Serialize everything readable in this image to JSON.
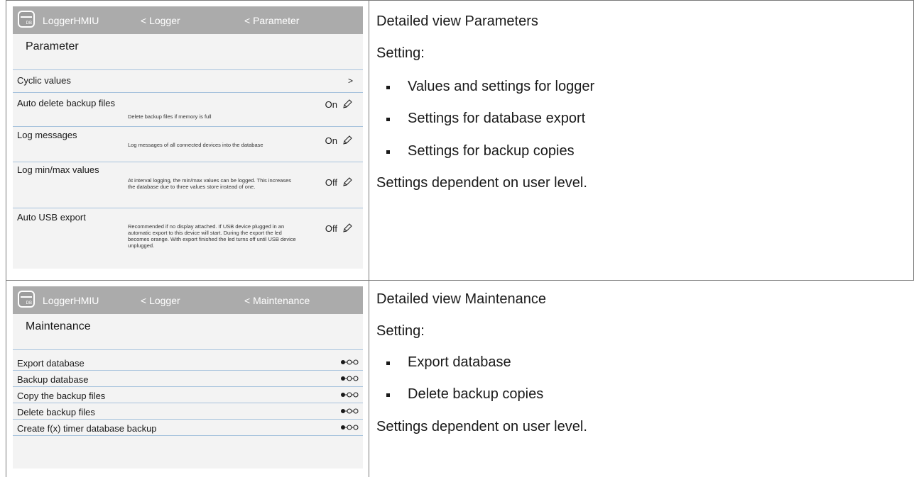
{
  "sections": [
    {
      "screen": {
        "app_name": "LoggerHMIU",
        "logo_label": "DB",
        "crumb1": "< Logger",
        "crumb2": "< Parameter",
        "title": "Parameter",
        "rows": [
          {
            "label": "Cyclic values",
            "desc": "",
            "value": "",
            "chevron": ">"
          },
          {
            "label": "Auto delete backup files",
            "desc": "Delete backup files if memory is full",
            "value": "On"
          },
          {
            "label": "Log messages",
            "desc": "Log messages of all connected devices into the database",
            "value": "On"
          },
          {
            "label": "Log min/max values",
            "desc": "At interval logging, the min/max values can be logged. This increases the database due to three values store instead of one.",
            "value": "Off"
          },
          {
            "label": "Auto USB export",
            "desc": "Recommended if no display attached. If USB device plugged in an automatic export to this device will start. During the export the led becomes orange. With export finished the led turns off until USB device unplugged.",
            "value": "Off"
          }
        ]
      },
      "text": {
        "heading": "Detailed view Parameters",
        "setting": "Setting:",
        "bullets": [
          "Values and settings for logger",
          "Settings for database export",
          "Settings for backup copies"
        ],
        "note": "Settings dependent on user level."
      }
    },
    {
      "screen": {
        "app_name": "LoggerHMIU",
        "logo_label": "DB",
        "crumb1": "< Logger",
        "crumb2": "< Maintenance",
        "title": "Maintenance",
        "rows": [
          {
            "label": "Export database"
          },
          {
            "label": "Backup database"
          },
          {
            "label": "Copy the backup files"
          },
          {
            "label": "Delete backup files"
          },
          {
            "label": "Create f(x) timer database backup"
          }
        ]
      },
      "text": {
        "heading": "Detailed view Maintenance",
        "setting": "Setting:",
        "bullets": [
          "Export database",
          "Delete backup copies"
        ],
        "note": "Settings dependent on user level."
      }
    }
  ],
  "icons": {
    "edit": "pencil-icon",
    "action": "action-dots-icon",
    "logo": "database-logo-icon"
  }
}
